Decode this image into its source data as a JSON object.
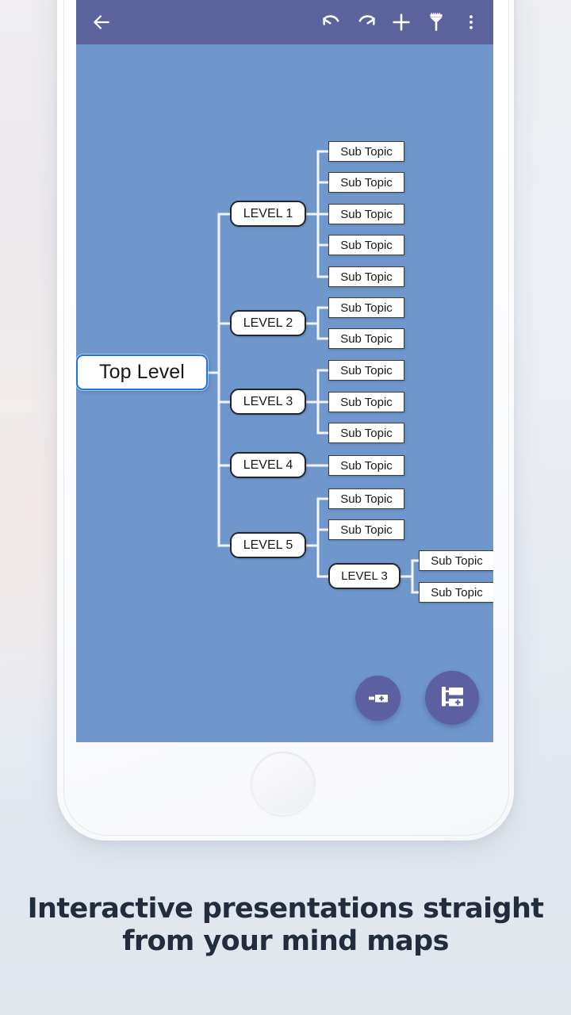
{
  "app": {
    "toolbar": {
      "back_label": "Back",
      "undo_label": "Undo",
      "redo_label": "Redo",
      "add_label": "Add",
      "brush_label": "Style",
      "overflow_label": "More options",
      "background_color": "#5b629c"
    },
    "canvas": {
      "background_color": "#6f97cc",
      "connector_color": "#ffffff"
    },
    "fabs": [
      {
        "name": "add-sibling-node",
        "label": "Add sibling node"
      },
      {
        "name": "add-child-node",
        "label": "Add child node"
      }
    ]
  },
  "mindmap": {
    "root": {
      "label": "Top Level",
      "selected": true,
      "accent_color": "#1a73e8"
    },
    "branches": [
      {
        "label": "LEVEL 1",
        "children": [
          {
            "label": "Sub Topic"
          },
          {
            "label": "Sub Topic"
          },
          {
            "label": "Sub Topic"
          },
          {
            "label": "Sub Topic"
          },
          {
            "label": "Sub Topic"
          }
        ]
      },
      {
        "label": "LEVEL 2",
        "children": [
          {
            "label": "Sub Topic"
          },
          {
            "label": "Sub Topic"
          }
        ]
      },
      {
        "label": "LEVEL 3",
        "children": [
          {
            "label": "Sub Topic"
          },
          {
            "label": "Sub Topic"
          },
          {
            "label": "Sub Topic"
          }
        ]
      },
      {
        "label": "LEVEL 4",
        "children": [
          {
            "label": "Sub Topic"
          }
        ]
      },
      {
        "label": "LEVEL 5",
        "children": [
          {
            "label": "Sub Topic"
          },
          {
            "label": "Sub Topic"
          },
          {
            "label": "LEVEL 3",
            "children": [
              {
                "label": "Sub Topic"
              },
              {
                "label": "Sub Topic"
              }
            ]
          }
        ]
      }
    ]
  },
  "caption": {
    "line1": "Interactive presentations straight",
    "line2": "from your mind maps"
  }
}
